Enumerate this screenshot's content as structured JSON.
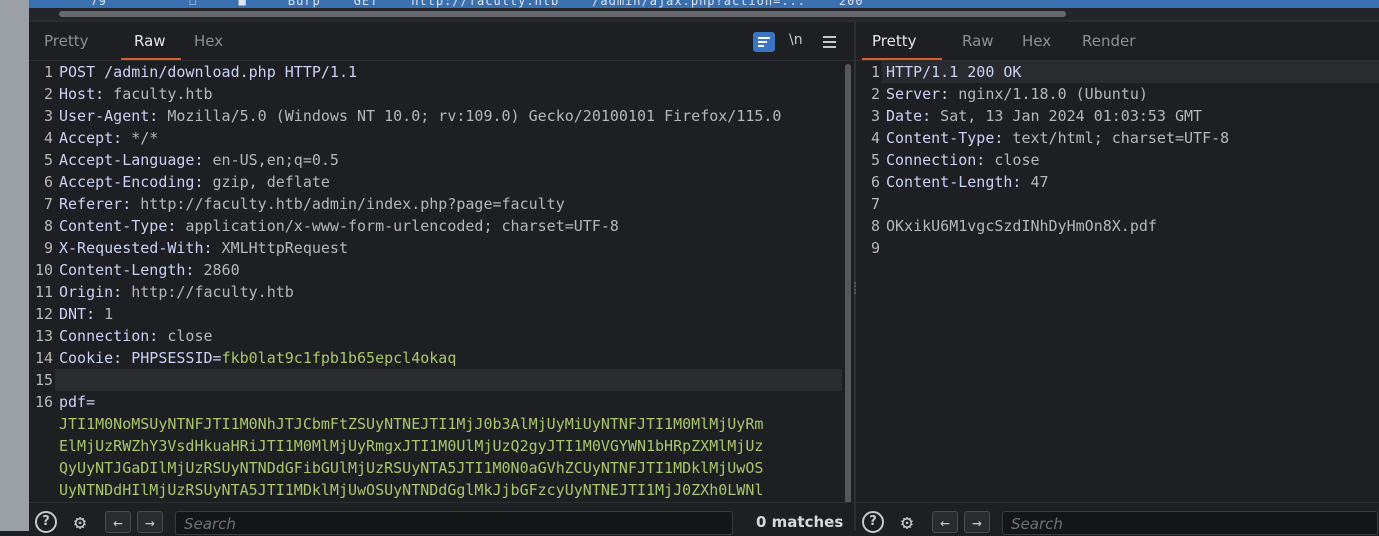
{
  "top_row_text": "  79          ☐     ■     Burp    GET    http://faculty.htb    /admin/ajax.php?action=...    200",
  "request": {
    "tabs": [
      "Pretty",
      "Raw",
      "Hex"
    ],
    "active_tab": "Raw",
    "newline_toggle": "\\n",
    "lines": [
      {
        "n": "1",
        "name": "POST /admin/download.php HTTP/1.1",
        "value": ""
      },
      {
        "n": "2",
        "name": "Host:",
        "value": " faculty.htb"
      },
      {
        "n": "3",
        "name": "User-Agent:",
        "value": " Mozilla/5.0 (Windows NT 10.0; rv:109.0) Gecko/20100101 Firefox/115.0"
      },
      {
        "n": "4",
        "name": "Accept:",
        "value": " */*"
      },
      {
        "n": "5",
        "name": "Accept-Language:",
        "value": " en-US,en;q=0.5"
      },
      {
        "n": "6",
        "name": "Accept-Encoding:",
        "value": " gzip, deflate"
      },
      {
        "n": "7",
        "name": "Referer:",
        "value": " http://faculty.htb/admin/index.php?page=faculty"
      },
      {
        "n": "8",
        "name": "Content-Type:",
        "value": " application/x-www-form-urlencoded; charset=UTF-8"
      },
      {
        "n": "9",
        "name": "X-Requested-With:",
        "value": " XMLHttpRequest"
      },
      {
        "n": "10",
        "name": "Content-Length:",
        "value": " 2860"
      },
      {
        "n": "11",
        "name": "Origin:",
        "value": " http://faculty.htb"
      },
      {
        "n": "12",
        "name": "DNT:",
        "value": " 1"
      },
      {
        "n": "13",
        "name": "Connection:",
        "value": " close"
      },
      {
        "n": "14",
        "name": "Cookie:",
        "value": " PHPSESSID=",
        "cookie": "fkb0lat9c1fpb1b65epcl4okaq"
      },
      {
        "n": "15",
        "name": "",
        "value": ""
      },
      {
        "n": "16",
        "name": "pdf=",
        "value": ""
      }
    ],
    "body_lines": [
      "JTI1M0NoMSUyNTNFJTI1M0NhJTJCbmFtZSUyNTNEJTI1MjJ0b3AlMjUyMiUyNTNFJTI1M0MlMjUyRm",
      "ElMjUzRWZhY3VsdHkuaHRiJTI1M0MlMjUyRmgxJTI1M0UlMjUzQ2gyJTI1M0VGYWN1bHRpZXMlMjUz",
      "QyUyNTJGaDIlMjUzRSUyNTNDdGFibGUlMjUzRSUyNTA5JTI1M0N0aGVhZCUyNTNFJTI1MDklMjUwOS",
      "UyNTNDdHIlMjUzRSUyNTA5JTI1MDklMjUwOSUyNTNDdGglMkJjbGFzcyUyNTNEJTI1MjJ0ZXh0LWNl"
    ],
    "search_placeholder": "Search",
    "matches": "0 matches"
  },
  "response": {
    "tabs": [
      "Pretty",
      "Raw",
      "Hex",
      "Render"
    ],
    "active_tab": "Pretty",
    "lines": [
      {
        "n": "1",
        "name": "HTTP/1.1 200 OK",
        "value": ""
      },
      {
        "n": "2",
        "name": "Server:",
        "value": " nginx/1.18.0 (Ubuntu)"
      },
      {
        "n": "3",
        "name": "Date:",
        "value": " Sat, 13 Jan 2024 01:03:53 GMT"
      },
      {
        "n": "4",
        "name": "Content-Type:",
        "value": " text/html; charset=UTF-8"
      },
      {
        "n": "5",
        "name": "Connection:",
        "value": " close"
      },
      {
        "n": "6",
        "name": "Content-Length:",
        "value": " 47"
      },
      {
        "n": "7",
        "name": "",
        "value": ""
      },
      {
        "n": "8",
        "name": "OKxikU6M1vgcSzdINhDyHmOn8X.pdf",
        "value": ""
      },
      {
        "n": "9",
        "name": "",
        "value": ""
      }
    ],
    "search_placeholder": "Search"
  },
  "icons": {
    "wrap": "word-wrap-icon",
    "menu": "hamburger-menu-icon",
    "help": "help-icon",
    "settings": "gear-icon",
    "prev": "arrow-left-icon",
    "next": "arrow-right-icon"
  },
  "colors": {
    "accent_underline": "#e05a2b",
    "wrap_button": "#3a74c4",
    "header_name": "#c9d1f5",
    "body_value": "#a9c76a"
  }
}
